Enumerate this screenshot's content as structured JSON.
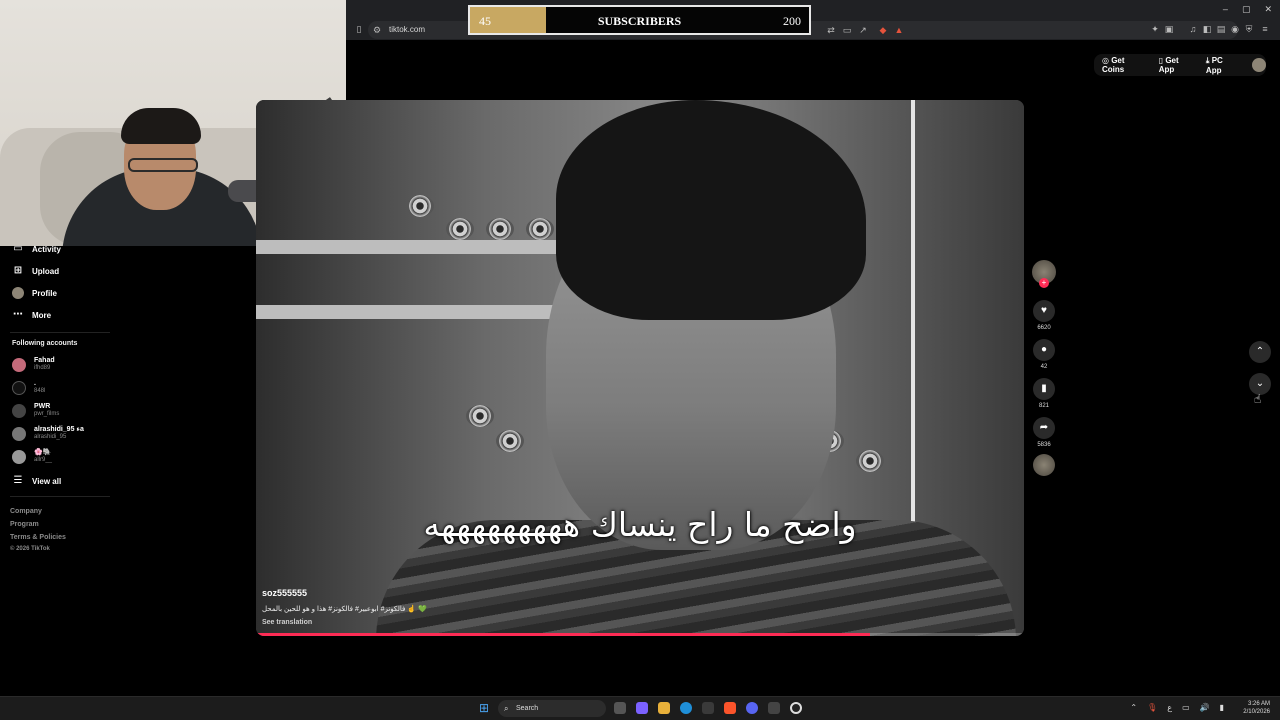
{
  "browser": {
    "url": "tiktok.com",
    "window_controls": [
      "–",
      "▢",
      "✕"
    ]
  },
  "overlay": {
    "current": "45",
    "label": "SUBSCRIBERS",
    "goal": "200",
    "progress_fraction": 0.225,
    "fill_color": "#c8a862"
  },
  "header": {
    "get_coins": "Get Coins",
    "get_app": "Get App",
    "pc_app": "PC App"
  },
  "sidebar": {
    "nav": [
      {
        "label": "Activity",
        "icon": "inbox-icon"
      },
      {
        "label": "Upload",
        "icon": "plus-square-icon"
      },
      {
        "label": "Profile",
        "icon": "avatar-icon"
      },
      {
        "label": "More",
        "icon": "ellipsis-icon"
      }
    ],
    "following_title": "Following accounts",
    "accounts": [
      {
        "name": "Fahad",
        "handle": "ifhd89"
      },
      {
        "name": ".",
        "handle": "848l"
      },
      {
        "name": "PWR",
        "handle": "pwr_films"
      },
      {
        "name": "alrashidi_95 ءa",
        "handle": "alrashidi_95"
      },
      {
        "name": "🌸🐘",
        "handle": "allr9__"
      }
    ],
    "view_all": "View all",
    "footer": [
      "Company",
      "Program",
      "Terms & Policies",
      "© 2026 TikTok"
    ]
  },
  "video": {
    "caption": "واضح ما راح ينساك هههههههههه",
    "author": "soz555555",
    "description": "💚 ☝️ فالكونز# ابوعبير# فالكونز# هذا و هو للحين بالمحل",
    "see_translation": "See translation",
    "progress_fraction": 0.8
  },
  "actions": {
    "likes": "6620",
    "comments": "42",
    "saves": "821",
    "shares": "5836"
  },
  "taskbar": {
    "search_label": "Search",
    "time": "3:26 AM",
    "date": "2/10/2026",
    "lang": "ع"
  }
}
